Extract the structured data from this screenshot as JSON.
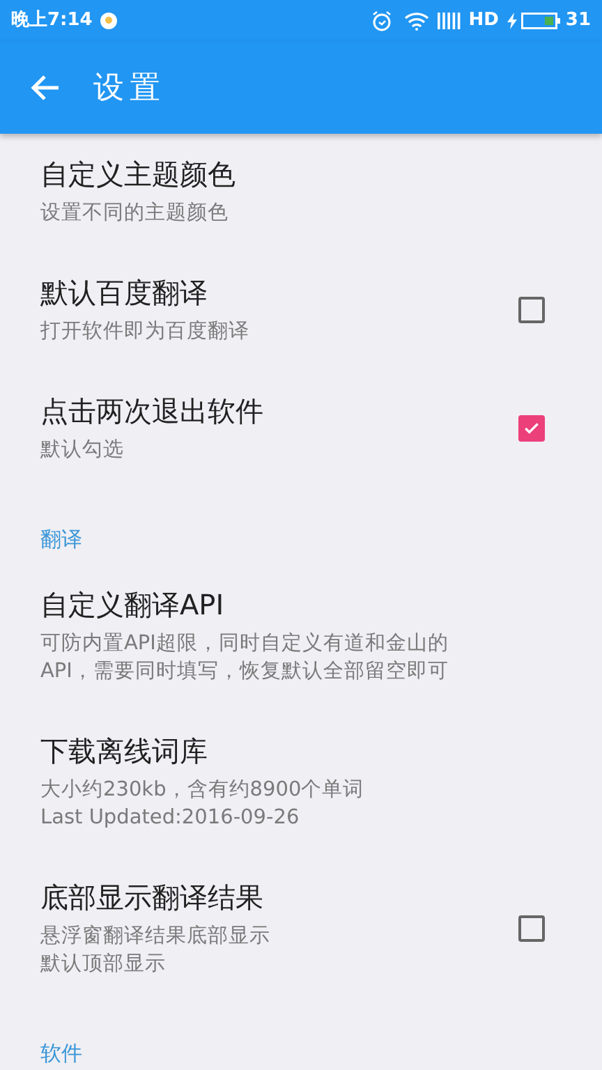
{
  "status_bar": {
    "time": "晚上7:14",
    "network": "HD",
    "battery": "31"
  },
  "toolbar": {
    "title": "设置"
  },
  "sections": [
    {
      "items": [
        {
          "kind": "plain",
          "title": "自定义主题颜色",
          "summary": [
            "设置不同的主题颜色"
          ]
        },
        {
          "kind": "checkbox",
          "title": "默认百度翻译",
          "summary": [
            "打开软件即为百度翻译"
          ],
          "checked": false
        },
        {
          "kind": "checkbox",
          "title": "点击两次退出软件",
          "summary": [
            "默认勾选"
          ],
          "checked": true
        }
      ]
    },
    {
      "header": "翻译",
      "items": [
        {
          "kind": "plain",
          "title": "自定义翻译API",
          "summary": [
            "可防内置API超限，同时自定义有道和金山的API，需要同时填写，恢复默认全部留空即可"
          ]
        },
        {
          "kind": "plain",
          "title": "下载离线词库",
          "summary": [
            "大小约230kb，含有约8900个单词",
            "Last Updated:2016-09-26"
          ]
        },
        {
          "kind": "checkbox",
          "title": "底部显示翻译结果",
          "summary": [
            "悬浮窗翻译结果底部显示",
            "默认顶部显示"
          ],
          "checked": false
        }
      ]
    },
    {
      "header": "软件"
    }
  ]
}
